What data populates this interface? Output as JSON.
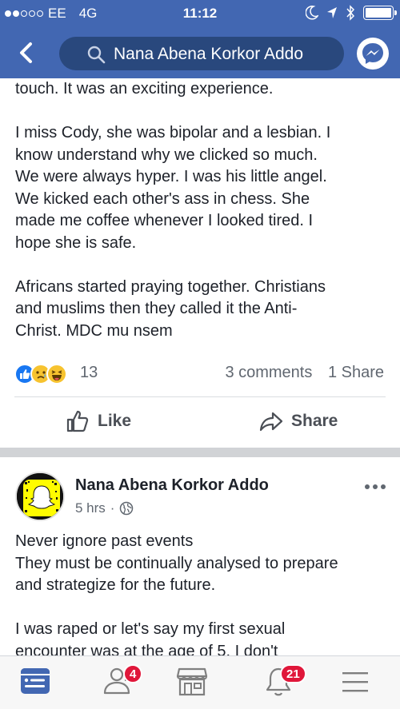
{
  "status_bar": {
    "carrier": "EE",
    "network": "4G",
    "time": "11:12"
  },
  "nav": {
    "search_text": "Nana Abena Korkor Addo"
  },
  "post1": {
    "lines": [
      "touch. It was an exciting experience.",
      "",
      "I miss Cody, she was bipolar and a lesbian. I",
      "know understand why we clicked so much.",
      "We were always hyper. I was his little angel.",
      "We kicked each other's ass in chess. She",
      "made me coffee whenever I looked tired. I",
      "hope she is safe.",
      "",
      "Africans started praying together. Christians",
      "and muslims then they called it the Anti-",
      "Christ. MDC mu nsem"
    ],
    "reaction_count": "13",
    "comments": "3 comments",
    "shares": "1 Share",
    "like_label": "Like",
    "share_label": "Share"
  },
  "post2": {
    "author": "Nana Abena Korkor Addo",
    "time": "5 hrs",
    "dot": "·",
    "lines": [
      "Never ignore past events",
      "They must be continually analysed to prepare",
      "and strategize for the future.",
      "",
      "I was raped or let's say my first sexual",
      "encounter was at the age of 5. I don't"
    ]
  },
  "tabbar": {
    "friends_badge": "4",
    "notifications_badge": "21"
  },
  "colors": {
    "brand": "#4267b2",
    "search_bg": "#29487d",
    "badge": "#e0173a",
    "active_tab": "#4267b2"
  },
  "icons": [
    "back-chevron-icon",
    "search-icon",
    "messenger-icon",
    "like-reaction-icon",
    "sad-reaction-icon",
    "haha-reaction-icon",
    "thumbs-up-icon",
    "share-arrow-icon",
    "globe-icon",
    "more-icon",
    "news-feed-icon",
    "friends-icon",
    "marketplace-icon",
    "bell-icon",
    "menu-icon"
  ]
}
